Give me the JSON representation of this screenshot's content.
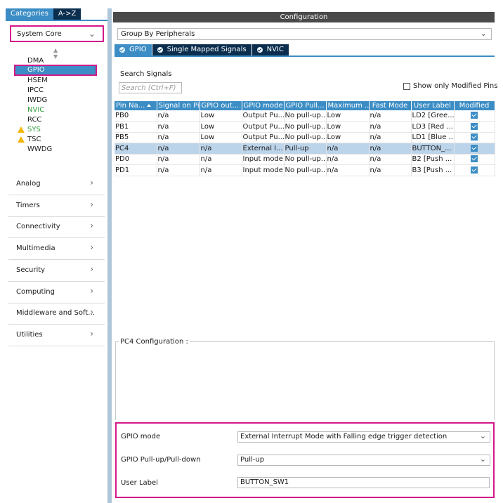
{
  "left": {
    "tabs": [
      "Categories",
      "A->Z"
    ],
    "system_core": "System Core",
    "system_core_items": [
      {
        "label": "DMA",
        "warn": false,
        "green": false
      },
      {
        "label": "GPIO",
        "warn": false,
        "green": false
      },
      {
        "label": "HSEM",
        "warn": false,
        "green": false
      },
      {
        "label": "IPCC",
        "warn": false,
        "green": false
      },
      {
        "label": "IWDG",
        "warn": false,
        "green": false
      },
      {
        "label": "NVIC",
        "warn": false,
        "green": true
      },
      {
        "label": "RCC",
        "warn": false,
        "green": false
      },
      {
        "label": "SYS",
        "warn": true,
        "green": true
      },
      {
        "label": "TSC",
        "warn": true,
        "green": false
      },
      {
        "label": "WWDG",
        "warn": false,
        "green": false
      }
    ],
    "categories": [
      "Analog",
      "Timers",
      "Connectivity",
      "Multimedia",
      "Security",
      "Computing",
      "Middleware and Soft...",
      "Utilities"
    ]
  },
  "config": {
    "title": "Configuration",
    "group_by": "Group By Peripherals",
    "tabs": [
      "GPIO",
      "Single Mapped Signals",
      "NVIC"
    ],
    "search_label": "Search Signals",
    "search_placeholder": "Search (Ctrl+F)",
    "show_modified": "Show only Modified Pins"
  },
  "table": {
    "headers": [
      "Pin Na...",
      "Signal on Pin",
      "GPIO out...",
      "GPIO mode",
      "GPIO Pull...",
      "Maximum ...",
      "Fast Mode",
      "User Label",
      "Modified"
    ],
    "rows": [
      [
        "PB0",
        "n/a",
        "Low",
        "Output Pu...",
        "No pull-up...",
        "Low",
        "n/a",
        "LD2 [Gree..."
      ],
      [
        "PB1",
        "n/a",
        "Low",
        "Output Pu...",
        "No pull-up...",
        "Low",
        "n/a",
        "LD3 [Red ..."
      ],
      [
        "PB5",
        "n/a",
        "Low",
        "Output Pu...",
        "No pull-up...",
        "Low",
        "n/a",
        "LD1 [Blue ..."
      ],
      [
        "PC4",
        "n/a",
        "n/a",
        "External I...",
        "Pull-up",
        "n/a",
        "n/a",
        "BUTTON_..."
      ],
      [
        "PD0",
        "n/a",
        "n/a",
        "Input mode",
        "No pull-up...",
        "n/a",
        "n/a",
        "B2 [Push ..."
      ],
      [
        "PD1",
        "n/a",
        "n/a",
        "Input mode",
        "No pull-up...",
        "n/a",
        "n/a",
        "B3 [Push ..."
      ]
    ],
    "selected_row": 3
  },
  "pc4": {
    "legend": "PC4 Configuration :",
    "gpio_mode_label": "GPIO mode",
    "gpio_mode_value": "External Interrupt Mode with Falling edge trigger detection",
    "pull_label": "GPIO Pull-up/Pull-down",
    "pull_value": "Pull-up",
    "user_label_label": "User Label",
    "user_label_value": "BUTTON_SW1"
  },
  "colors": {
    "accent": "#3c8dc5",
    "dark_tab": "#0b2e4f",
    "highlight": "#d4188a",
    "green_item": "#2e9a3a",
    "warning": "#f2b705"
  }
}
